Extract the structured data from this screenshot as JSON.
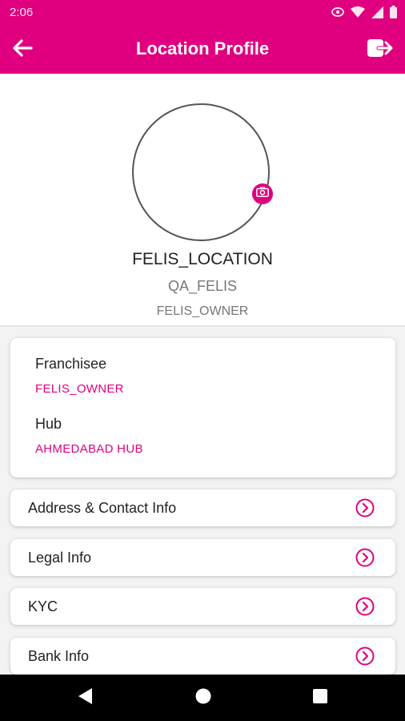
{
  "status_bar": {
    "time": "2:06",
    "icons": [
      "eye-icon",
      "wifi-icon",
      "signal-icon",
      "battery-icon"
    ]
  },
  "app_bar": {
    "title": "Location Profile",
    "back_icon": "arrow-left-icon",
    "logout_icon": "logout-icon"
  },
  "profile": {
    "name": "FELIS_LOCATION",
    "code": "QA_FELIS",
    "owner": "FELIS_OWNER",
    "camera_icon": "camera-icon"
  },
  "info_card": {
    "franchisee_label": "Franchisee",
    "franchisee_value": "FELIS_OWNER",
    "hub_label": "Hub",
    "hub_value": "AHMEDABAD HUB"
  },
  "menu": {
    "items": [
      {
        "label": "Address & Contact Info",
        "icon": "chevron-right-circle-icon"
      },
      {
        "label": "Legal Info",
        "icon": "chevron-right-circle-icon"
      },
      {
        "label": "KYC",
        "icon": "chevron-right-circle-icon"
      },
      {
        "label": "Bank Info",
        "icon": "chevron-right-circle-icon"
      }
    ]
  },
  "nav_bar": {
    "icons": [
      "back-triangle-icon",
      "home-circle-icon",
      "recents-square-icon"
    ]
  },
  "colors": {
    "brand": "#e0007f",
    "text": "#222222",
    "muted": "#777777",
    "background": "#f3f3f3"
  }
}
